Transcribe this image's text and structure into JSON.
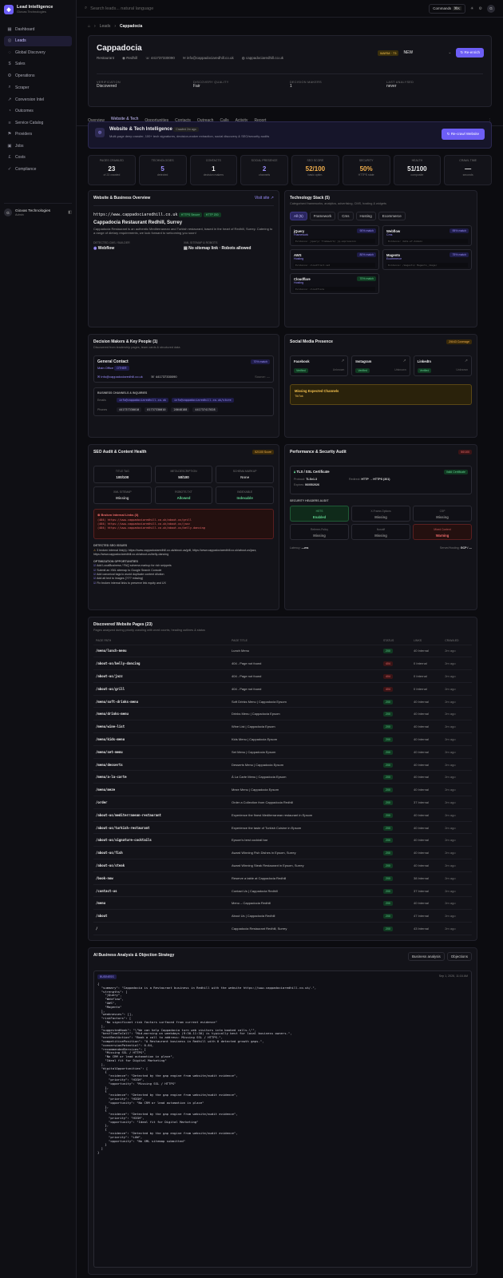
{
  "sidebar": {
    "app": "Lead Intelligence",
    "org": "Giovas Technologies",
    "items": [
      {
        "icon": "▦",
        "label": "Dashboard"
      },
      {
        "icon": "◎",
        "label": "Leads",
        "active": true
      },
      {
        "icon": "◌",
        "label": "Global Discovery"
      },
      {
        "icon": "$",
        "label": "Sales"
      },
      {
        "icon": "⚙",
        "label": "Operations"
      },
      {
        "icon": "⌕",
        "label": "Scraper"
      },
      {
        "icon": "↗",
        "label": "Conversion Intel"
      },
      {
        "icon": "◔",
        "label": "Outcomes"
      },
      {
        "icon": "≡",
        "label": "Service Catalog"
      },
      {
        "icon": "⚑",
        "label": "Providers"
      },
      {
        "icon": "▣",
        "label": "Jobs"
      },
      {
        "icon": "£",
        "label": "Costs"
      },
      {
        "icon": "✓",
        "label": "Compliance"
      }
    ],
    "user": "Giovas Technologies",
    "user_sub": "Admin",
    "user_initial": "G"
  },
  "topbar": {
    "search": "Search leads... natural language",
    "commands": "Commands",
    "shortcut": "⌘K",
    "initial": "G"
  },
  "breadcrumb": [
    "Leads",
    "Cappadocia"
  ],
  "lead": {
    "name": "Cappadocia",
    "category": "Restaurant",
    "city": "Redhill",
    "phone": "441737330090",
    "email": "info@cappadociaredhill.co.uk",
    "site": "cappadociaredhill.co.uk",
    "warm": "WARM · 73",
    "status": "NEW",
    "reenrich": "Re-enrich",
    "kv": [
      {
        "k": "VERIFICATION",
        "v": "Discovered"
      },
      {
        "k": "DISCOVERY QUALITY",
        "v": "Fair"
      },
      {
        "k": "DECISION MAKERS",
        "v": "1"
      },
      {
        "k": "LAST ANALYSED",
        "v": "never"
      }
    ]
  },
  "tabs": [
    "Overview",
    "Website & Tech",
    "Opportunities",
    "Contacts",
    "Outreach",
    "Calls",
    "Activity",
    "Report"
  ],
  "intel": {
    "title": "Website & Tech Intelligence",
    "badge": "Crawled 2m ago",
    "desc": "Multi-page deep crawler, 100+ tech signatures, decision-maker extraction, social discovery & SEO/security audits",
    "button": "Re-crawl Website"
  },
  "stats": [
    {
      "k": "PAGES CRAWLED",
      "v": "23",
      "s": "of 23 crawled",
      "c": "#eee"
    },
    {
      "k": "TECHNOLOGIES",
      "v": "5",
      "s": "detected",
      "c": "#9c90ff"
    },
    {
      "k": "CONTACTS",
      "v": "1",
      "s": "decision makers",
      "c": "#eee"
    },
    {
      "k": "SOCIAL PRESENCE",
      "v": "2",
      "s": "channels",
      "c": "#9c90ff"
    },
    {
      "k": "SEO SCORE",
      "v": "52/100",
      "s": "basic optim.",
      "c": "#f4b14e"
    },
    {
      "k": "SECURITY",
      "v": "50%",
      "s": "HTTPS state",
      "c": "#f4b14e"
    },
    {
      "k": "HEALTH",
      "v": "51/100",
      "s": "composite",
      "c": "#eee"
    },
    {
      "k": "CRAWL TIME",
      "v": "—",
      "s": "seconds",
      "c": "#eee"
    }
  ],
  "overview": {
    "title": "Website & Business Overview",
    "visit": "Visit site",
    "url": "https://www.cappadociaredhill.co.uk",
    "b1": "HTTPS Secure",
    "b2": "HTTP 200",
    "name": "Cappadocia Restaurant Redhill, Surrey",
    "desc": "Cappadocia Restaurant is an authentic Mediterranean and Turkish restaurant, based in the heart of Redhill, Surrey. Catering to a range of dietary requirements, we look forward to welcoming you soon!",
    "cms_k": "DETECTED CMS / BUILDER",
    "cms": "Webflow",
    "map_k": "XML SITEMAP & ROBOTS",
    "map": "No sitemap link · Robots allowed"
  },
  "tech": {
    "title": "Technology Stack (5)",
    "sub": "Categorised frameworks, analytics, advertising, CMS, hosting & widgets",
    "filters": [
      "All (5)",
      "Framework",
      "Cms",
      "Hosting",
      "Ecommerce"
    ],
    "items": [
      {
        "n": "jQuery",
        "c": "Framework",
        "m": "90% match",
        "e": "Evidence: jquery/ framework/ jq-expression"
      },
      {
        "n": "Webflow",
        "c": "Cms",
        "m": "95% match",
        "e": "Evidence: data-wf-domain"
      },
      {
        "n": "AWS",
        "c": "Hosting",
        "m": "80% match",
        "e": "Evidence: cloudfront.net"
      },
      {
        "n": "Magento",
        "c": "Ecommerce",
        "m": "75% match",
        "e": "Evidence: /magento/ Magento_/mage/"
      },
      {
        "n": "Cloudflare",
        "c": "Hosting",
        "m": "70% match",
        "e": "Evidence: cloudflare"
      }
    ]
  },
  "people": {
    "title": "Decision Makers & Key People (1)",
    "sub": "Discovered from leadership pages, team cards & structured data",
    "name": "General Contact",
    "conf": "70% match",
    "role": "Main Office",
    "tag": "OTHER",
    "email": "info@cappadociaredhill.co.uk",
    "phone": "441737330090",
    "src": "Source: —",
    "chan": "BUSINESS CHANNELS & INQUIRIES",
    "emails_k": "Emails",
    "emails": [
      "info@cappadociaredhill.co.uk",
      "info@cappadociaredhill.co.uk/store"
    ],
    "phones_k": "Phones",
    "phones": [
      "441737330010",
      "01737330010",
      "28648188",
      "441737417028"
    ]
  },
  "social": {
    "title": "Social Media Presence",
    "cov": "2/6/43 Coverage",
    "items": [
      {
        "n": "Facebook",
        "s": "Verified",
        "l": "Unknown"
      },
      {
        "n": "Instagram",
        "s": "Verified",
        "l": "Unknown"
      },
      {
        "n": "LinkedIn",
        "s": "Verified",
        "l": "Unknown"
      }
    ],
    "missing": "Missing Expected Channels",
    "missing_v": "TikTok"
  },
  "seo": {
    "title": "SEO Audit & Content Health",
    "score": "52/100 Score",
    "cells": [
      {
        "k": "TITLE TAG",
        "v": "100/100"
      },
      {
        "k": "META DESCRIPTION",
        "v": "50/100"
      },
      {
        "k": "SCHEMA MARKUP",
        "v": "None"
      },
      {
        "k": "XML SITEMAP",
        "v": "Missing"
      },
      {
        "k": "ROBOTS.TXT",
        "v": "Allowed"
      },
      {
        "k": "INDEXABLE",
        "v": "Indexable"
      }
    ],
    "broken_t": "Broken Internal Links (3)",
    "broken": [
      "(404) https://www.cappadociaredhill.co.uk/about-us/grill",
      "(404) https://www.cappadociaredhill.co.uk/about-us/jazz",
      "(404) https://www.cappadociaredhill.co.uk/about-us/belly-dancing"
    ],
    "issues_t": "DETECTED SEO ISSUES",
    "issue": "3 broken internal link(s): https://www.cappadociaredhill.co.uk/about-us/grill, https://www.cappadociaredhill.co.uk/about-us/jazz, https://www.cappadociaredhill.co.uk/about-us/belly-dancing",
    "opp_t": "OPTIMIZATION OPPORTUNITIES",
    "opps": [
      "Add LocalBusiness / FAQ schema markup for rich snippets",
      "Submit an XML sitemap to Google Search Console",
      "Add canonical tags to avoid duplicate content dilution",
      "Add alt text to images (?/?? missing)",
      "Fix broken internal links to preserve link equity and UX"
    ]
  },
  "perf": {
    "title": "Performance & Security Audit",
    "badge": "50/100",
    "tls": "TLS / SSL Certificate",
    "valid": "Valid Certificate",
    "proto_k": "Protocol:",
    "proto": "TLSv1.3",
    "red_k": "Redirect:",
    "red": "HTTP → HTTPS (301)",
    "exp_k": "Expires:",
    "exp": "06/05/2026",
    "hdr_t": "SECURITY HEADERS AUDIT",
    "hdrs": [
      {
        "k": "HSTS",
        "v": "Enabled",
        "c": "g"
      },
      {
        "k": "X-Frame-Options",
        "v": "Missing",
        "c": "n"
      },
      {
        "k": "CSP",
        "v": "Missing",
        "c": "n"
      },
      {
        "k": "Referrer-Policy",
        "v": "Missing",
        "c": "n"
      },
      {
        "k": "Nosniff",
        "v": "Missing",
        "c": "n"
      },
      {
        "k": "Mixed Content",
        "v": "Warning",
        "c": "r"
      }
    ],
    "lat_k": "Latency:",
    "lat": "—ms",
    "srv_k": "Server/Hosting:",
    "srv": "GCP / —"
  },
  "pages": {
    "title": "Discovered Website Pages (23)",
    "sub": "Pages analyzed during priority crawling with word counts, heading outlines & status",
    "cols": [
      "PAGE PATH",
      "PAGE TITLE",
      "STATUS",
      "LINKS",
      "CRAWLED"
    ],
    "rows": [
      [
        "/menu/lunch-menu",
        "Lunch Menu",
        "200",
        "40 Internal",
        "2m ago"
      ],
      [
        "/about-us/belly-dancing",
        "404 - Page not found",
        "404",
        "0 Internal",
        "2m ago"
      ],
      [
        "/about-us/jazz",
        "404 - Page not found",
        "404",
        "0 Internal",
        "2m ago"
      ],
      [
        "/about-us/grill",
        "404 - Page not found",
        "404",
        "0 Internal",
        "2m ago"
      ],
      [
        "/menu/soft-drinks-menu",
        "Soft Drinks Menu | Cappadocia Epsom",
        "200",
        "40 Internal",
        "2m ago"
      ],
      [
        "/menu/drinks-menu",
        "Drinks Menu | Cappadocia Epsom",
        "200",
        "40 Internal",
        "2m ago"
      ],
      [
        "/menu/wine-list",
        "Wine List | Cappadocia Epsom",
        "200",
        "40 Internal",
        "2m ago"
      ],
      [
        "/menu/kids-menu",
        "Kids Menu | Cappadocia Epsom",
        "200",
        "40 Internal",
        "2m ago"
      ],
      [
        "/menu/set-menu",
        "Set Menu | Cappadocia Epsom",
        "200",
        "40 Internal",
        "2m ago"
      ],
      [
        "/menu/desserts",
        "Desserts Menu | Cappadocia Epsom",
        "200",
        "40 Internal",
        "2m ago"
      ],
      [
        "/menu/a-la-carte",
        "À La Carte Menu | Cappadocia Epsom",
        "200",
        "40 Internal",
        "2m ago"
      ],
      [
        "/menu/meze",
        "Meze Menu | Cappadocia Epsom",
        "200",
        "40 Internal",
        "2m ago"
      ],
      [
        "/order",
        "Order a Collection from Cappadocia Redhill",
        "200",
        "37 Internal",
        "2m ago"
      ],
      [
        "/about-us/mediterranean-restaurant",
        "Experience the finest Mediterranean restaurant in Epsom",
        "200",
        "40 Internal",
        "2m ago"
      ],
      [
        "/about-us/turkish-restaurant",
        "Experience the taste of Turkish Cuisine in Epsom",
        "200",
        "40 Internal",
        "2m ago"
      ],
      [
        "/about-us/signature-cocktails",
        "Epsom's best cocktail bar",
        "200",
        "40 Internal",
        "2m ago"
      ],
      [
        "/about-us/fish",
        "Award Winning Fish Dishes in Epsom, Surrey",
        "200",
        "40 Internal",
        "2m ago"
      ],
      [
        "/about-us/steak",
        "Award Winning Steak Restaurant in Epsom, Surrey",
        "200",
        "40 Internal",
        "2m ago"
      ],
      [
        "/book-now",
        "Reserve a table at Cappadocia Redhill",
        "200",
        "38 Internal",
        "2m ago"
      ],
      [
        "/contact-us",
        "Contact Us | Cappadocia Redhill",
        "200",
        "37 Internal",
        "2m ago"
      ],
      [
        "/menu",
        "Menu – Cappadocia Redhill",
        "200",
        "40 Internal",
        "2m ago"
      ],
      [
        "/about",
        "About Us | Cappadocia Redhill",
        "200",
        "47 Internal",
        "2m ago"
      ],
      [
        "/",
        "Cappadocia Restaurant Redhill, Surrey",
        "200",
        "43 Internal",
        "2m ago"
      ]
    ]
  },
  "ai": {
    "title": "AI Business Analysis & Objection Strategy",
    "b1": "Business analysis",
    "b2": "Objections",
    "tag": "BUSINESS",
    "date": "Sep 1, 2026, 11:16 AM",
    "json": "{\n  \"summary\": \"Cappadocia is a Restaurant business in Redhill with the website https://www.cappadociaredhill.co.uk/.\",\n  \"strengths\": [\n    \"jQuery\",\n    \"Webflow\",\n    \"AWS\",\n    \"Magento\"\n  ],\n  \"weaknesses\": [],\n  \"riskFactors\": [\n    \"No significant risk factors surfaced from current evidence\"\n  ],\n  \"suggestedHook\": \"\\\"We can help Cappadocia turn web visitors into booked calls.\\\"\",\n  \"bestTimeToCall\": \"Mid-morning on weekdays (9:30-11:30) is typically best for local business owners.\",\n  \"nextBestAction\": \"Book a call to address: Missing SSL / HTTPS.\",\n  \"competitivePosition\": \"A Restaurant business in Redhill with 0 detected growth gaps.\",\n  \"conversionPotential\": 0.84,\n  \"recommendedServices\": [\n    \"Missing SSL / HTTPS\",\n    \"No CRM or lead automation in place\",\n    \"Ideal fit for Digital Marketing\"\n  ],\n  \"digitalOpportunities\": [\n    {\n      \"evidence\": \"Detected by the gap engine from website/audit evidence\",\n      \"priority\": \"HIGH\",\n      \"opportunity\": \"Missing SSL / HTTPS\"\n    },\n    {\n      \"evidence\": \"Detected by the gap engine from website/audit evidence\",\n      \"priority\": \"HIGH\",\n      \"opportunity\": \"No CRM or lead automation in place\"\n    },\n    {\n      \"evidence\": \"Detected by the gap engine from website/audit evidence\",\n      \"priority\": \"HIGH\",\n      \"opportunity\": \"Ideal fit for Digital Marketing\"\n    },\n    {\n      \"evidence\": \"Detected by the gap engine from website/audit evidence\",\n      \"priority\": \"LOW\",\n      \"opportunity\": \"No XML sitemap submitted\"\n    }\n  ]\n}"
  }
}
